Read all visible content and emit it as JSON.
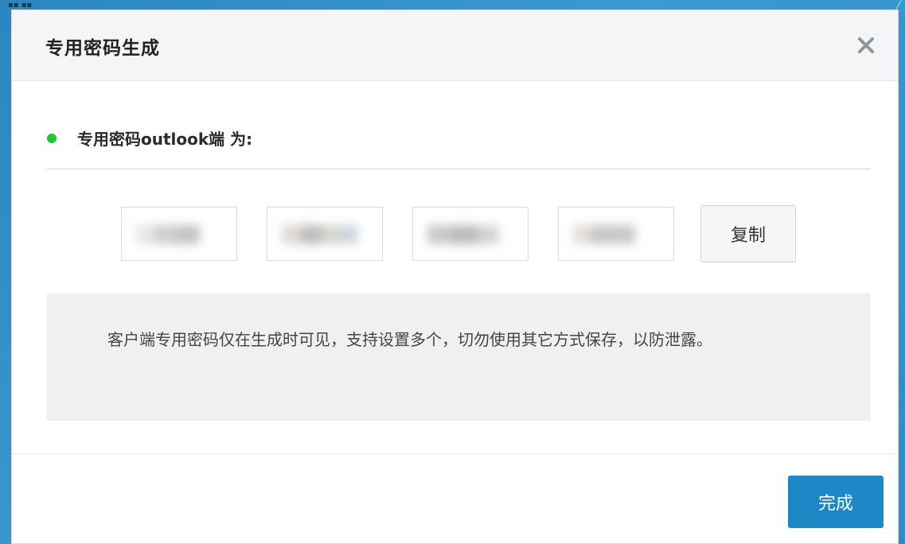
{
  "dialog": {
    "title": "专用密码生成",
    "close_icon": "close-icon"
  },
  "section": {
    "indicator_color": "#22c433",
    "label": "专用密码outlook端 为:"
  },
  "password": {
    "segments": [
      "",
      "",
      "",
      ""
    ],
    "obscured": true,
    "copy_label": "复制"
  },
  "notice": {
    "text": "客户端专用密码仅在生成时可见，支持设置多个，切勿使用其它方式保存，以防泄露。"
  },
  "footer": {
    "done_label": "完成",
    "accent_color": "#1e88c7"
  }
}
